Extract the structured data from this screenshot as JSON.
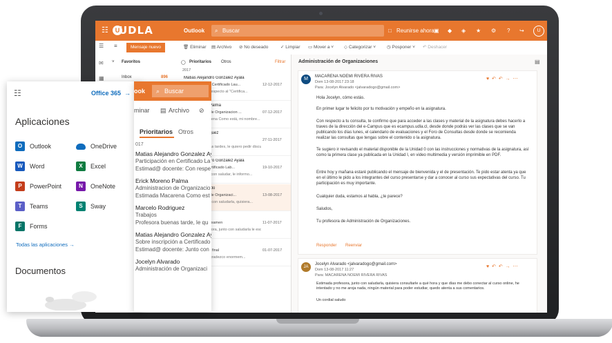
{
  "topbar": {
    "app_label": "Outlook",
    "brand": "UDLA",
    "search_placeholder": "Buscar",
    "meeting_label": "Reunirse ahora",
    "avatar_initial": "U"
  },
  "commands": {
    "new_mail": "Mensaje nuevo",
    "delete": "Eliminar",
    "archive": "Archivo",
    "junk": "No deseado",
    "sweep": "Limpiar",
    "move": "Mover a",
    "categorize": "Categorizar",
    "snooze": "Posponer",
    "undo": "Deshacer"
  },
  "folders": {
    "favorites": "Favoritos",
    "inbox": "Inbox",
    "inbox_count": "896"
  },
  "message_list": {
    "tab_focused": "Prioritarios",
    "tab_other": "Otros",
    "filter": "Filtrar",
    "year": "2017",
    "items": [
      {
        "sender": "Matias Alejandro Gonzalez Ayala",
        "subject": "Participación en Certificado Lau...",
        "date": "12-12-2017",
        "preview": "Estimado: Con respecto al \"Certifica..."
      },
      {
        "sender": "Erick Moreno Palma",
        "subject": "Administracion de Organizacion ...",
        "date": "07-12-2017",
        "preview": "Estimada Macarena Como está, mi nombre..."
      },
      {
        "sender": "Marcelo Rodriguez",
        "subject": "Trabajos",
        "date": "27-11-2017",
        "preview": "Profesora buenas tardes, le quiero pedir discu..."
      },
      {
        "sender": "Matias Alejandro Gonzalez Ayala",
        "subject": "Inscripción a Certificado Lab...",
        "date": "19-10-2017",
        "preview": "Estimado: junto con saludar, le informo..."
      },
      {
        "sender": "Jocelyn Alvarado",
        "subject": "Administración de Organizaci...",
        "date": "13-08-2017",
        "preview": "Profesora, junto con saludarla, quisiera..."
      },
      {
        "sender": "Certificados",
        "subject": "Resultados de examen",
        "date": "11-07-2017",
        "preview": "Estimada profesora, junto con saludarla le esc..."
      },
      {
        "sender": "Ricardo Pavez",
        "subject": "Revisión trabajo final",
        "date": "01-07-2017",
        "preview": "Profesora: Le agradezco enormem..."
      }
    ]
  },
  "reading": {
    "subject": "Administración de Organizaciones",
    "mail1": {
      "avatar": "M",
      "sender": "MACARENA NOEMI RIVERA RIVAS",
      "date": "Dom 13-08-2017 23:18",
      "to": "Para: Jocelyn Alvarado <jalvaradogo@gmail.com>",
      "greeting": "Hola Jocelyn, cómo estás.",
      "p1": "En primer lugar te felicito por tu motivación y empeño en la asignatura.",
      "p2": "Con respecto a tu consulta, te confirmo que para acceder a las clases y material de la asignatura debes hacerlo a traves de la dirección del e-Campus que es ecampus.udla.cl, desde donde podrás ver las clases que se van publicando los días lunes, el calendario de evaluaciones y el Foro de Consultas desde donde se recomienda realizar las consultas que tengas sobre el contenido o la asignatura.",
      "p3": "Te sugiero ir revisando el material disponible de la Unidad 0 con las instrucciones y normativas de la asignatura, así como la primera clase ya publicada en la Unidad I, en video multimedia y versión imprimible en PDF.",
      "p4": "Entre hoy y mañana estaré publicando el mensaje de bienvenida y el de presentación. Te pido estar atenta ya que en el último le pido a los integrantes del curso presentarse y dar a conocer al curso sus expectativas del curso. Tu participación es muy importante.",
      "p5": "Cualquier duda, estamos al habla, ¿te parece?",
      "p6": "Saludos,",
      "p7": "Tu profesora de Administración de Organizaciones.",
      "reply": "Responder",
      "forward": "Reenviar"
    },
    "mail2": {
      "avatar": "JA",
      "sender": "Jocelyn Alvarado <jalvaradogo@gmail.com>",
      "date": "Dom 13-08-2017 11:27",
      "to": "Para: MACARENA NOEMI RIVERA RIVAS",
      "p1": "Estimada profesora, junto con saludarla, quisiera consultarle a qué hora y que días me debo conectar al curso online, he intentado y no me aroja nada, ningún material para poder estudiar, quedo atenta a sus comentarios.",
      "p2": "Un cordial saludo"
    }
  },
  "apps_panel": {
    "office_link": "Office 365",
    "title": "Aplicaciones",
    "apps": [
      {
        "name": "Outlook",
        "letter": "O",
        "color": "#0f6cbd"
      },
      {
        "name": "OneDrive",
        "letter": "",
        "color": "#0f6cbd"
      },
      {
        "name": "Word",
        "letter": "W",
        "color": "#185abd"
      },
      {
        "name": "Excel",
        "letter": "X",
        "color": "#107c41"
      },
      {
        "name": "PowerPoint",
        "letter": "P",
        "color": "#c43e1c"
      },
      {
        "name": "OneNote",
        "letter": "N",
        "color": "#7719aa"
      },
      {
        "name": "Teams",
        "letter": "T",
        "color": "#5b5fc7"
      },
      {
        "name": "Sway",
        "letter": "S",
        "color": "#008272"
      },
      {
        "name": "Forms",
        "letter": "F",
        "color": "#077568"
      }
    ],
    "all_apps": "Todas las aplicaciones",
    "documents": "Documentos"
  },
  "zoom": {
    "app_fragment": "ook",
    "search": "Buscar",
    "delete_fragment": "minar",
    "archive": "Archivo",
    "tab_focused": "Prioritarios",
    "tab_other": "Otros",
    "year": "017",
    "rows": [
      {
        "l1": "Matias Alejandro Gonzalez Ay",
        "l2": "Participación en Certificado La",
        "l3": "Estimad@ docente: Con respe"
      },
      {
        "l1": "Erick Moreno Palma",
        "l2": "Administracion de Organizacio",
        "l3": "Estimada Macarena Como est"
      },
      {
        "l1": "Marcelo Rodriguez",
        "l2": "Trabajos",
        "l3": "Profesora buenas tarde, le qu"
      },
      {
        "l1": "Matias Alejandro Gonzalez Ay",
        "l2": "Sobre inscripción a Certificado",
        "l3": "Estimad@ docente: Junto con"
      },
      {
        "l1": "Jocelyn Alvarado",
        "l2": "Administración de Organizaci",
        "l3": ""
      }
    ]
  }
}
